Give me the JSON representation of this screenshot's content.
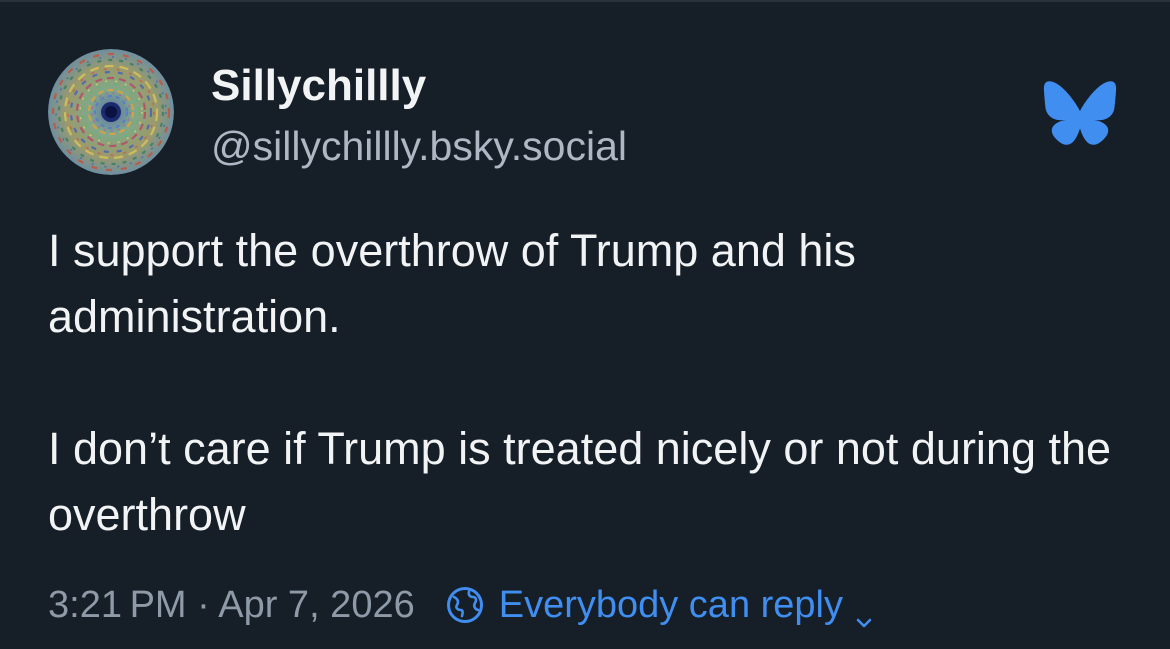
{
  "author": {
    "display_name": "Sillychillly",
    "handle": "@sillychillly.bsky.social",
    "avatar_icon": "spiral-pattern-avatar"
  },
  "brand": {
    "logo_icon": "bluesky-butterfly-icon",
    "accent_color": "#3f8ef0"
  },
  "post": {
    "paragraphs": [
      "I support the overthrow of Trump and his administration.",
      "I don’t care if Trump is treated nicely or not during the overthrow"
    ],
    "timestamp": "3:21 PM · Apr 7, 2026",
    "reply_setting": "Everybody can reply",
    "reply_icon": "globe-icon"
  },
  "colors": {
    "background": "#161e27",
    "text": "#f1f3f5",
    "secondary_text": "#aeb8c4",
    "meta_text": "#8e9aa7"
  }
}
